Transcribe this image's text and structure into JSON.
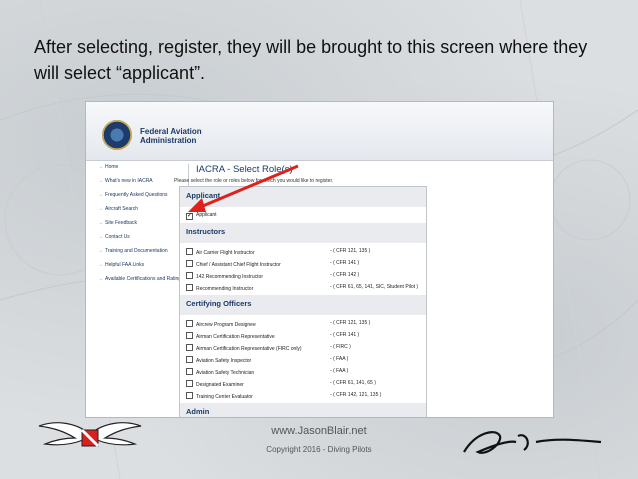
{
  "caption": "After selecting, register, they will be brought to this screen where they will select “applicant”.",
  "faa": {
    "title_line1": "Federal Aviation",
    "title_line2": "Administration"
  },
  "sidebar": {
    "items": [
      {
        "label": "Home"
      },
      {
        "label": "What's new in IACRA"
      },
      {
        "label": "Frequently Asked Questions"
      },
      {
        "label": "Aircraft Search"
      },
      {
        "label": "Site Feedback"
      },
      {
        "label": "Contact Us"
      },
      {
        "label": "Training and Documentation"
      },
      {
        "label": "Helpful FAA Links"
      },
      {
        "label": "Available Certifications and Ratings"
      }
    ]
  },
  "page": {
    "title": "IACRA - Select Role(s)",
    "subtitle": "Please select the role or roles below for which you would like to register."
  },
  "sections": {
    "applicant": {
      "heading": "Applicant",
      "roles": [
        {
          "label": "Applicant",
          "checked": true,
          "value": ""
        }
      ]
    },
    "instructors": {
      "heading": "Instructors",
      "roles": [
        {
          "label": "Air Carrier Flight Instructor",
          "checked": false,
          "value": "( CFR 121, 135 )"
        },
        {
          "label": "Chief / Assistant Chief Flight Instructor",
          "checked": false,
          "value": "( CFR 141 )"
        },
        {
          "label": "142 Recommending Instructor",
          "checked": false,
          "value": "( CFR 142 )"
        },
        {
          "label": "Recommending Instructor",
          "checked": false,
          "value": "( CFR 61, 65, 141, SIC, Student Pilot )"
        }
      ]
    },
    "certifying": {
      "heading": "Certifying Officers",
      "roles": [
        {
          "label": "Aircrew Program Designee",
          "checked": false,
          "value": "( CFR 121, 135 )"
        },
        {
          "label": "Airman Certification Representative",
          "checked": false,
          "value": "( CFR 141 )"
        },
        {
          "label": "Airman Certification Representative (FIRC only)",
          "checked": false,
          "value": "( FIRC )"
        },
        {
          "label": "Aviation Safety Inspector",
          "checked": false,
          "value": "( FAA )"
        },
        {
          "label": "Aviation Safety Technician",
          "checked": false,
          "value": "( FAA )"
        },
        {
          "label": "Designated Examiner",
          "checked": false,
          "value": "( CFR 61, 141, 65 )"
        },
        {
          "label": "Training Center Evaluator",
          "checked": false,
          "value": "( CFR 142, 121, 135 )"
        }
      ]
    },
    "admin": {
      "heading": "Admin"
    }
  },
  "dash": "-",
  "footer": {
    "site": "www.JasonBlair.net",
    "copyright": "Copyright 2016 - Diving Pilots"
  },
  "colors": {
    "link": "#1b3a66",
    "arrow": "#e0201b"
  }
}
